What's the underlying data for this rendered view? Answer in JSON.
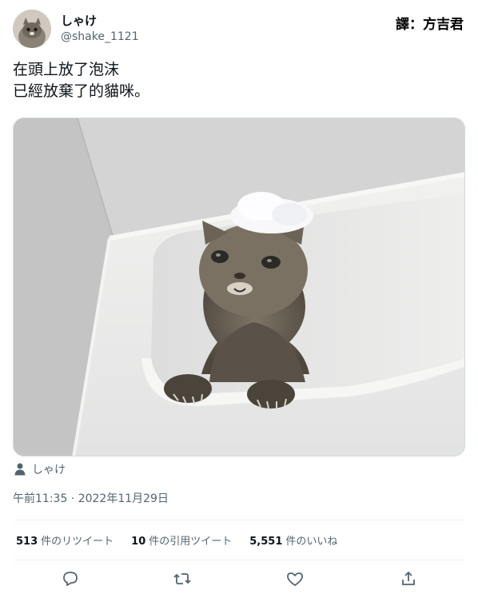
{
  "user": {
    "display_name": "しゃけ",
    "handle": "@shake_1121"
  },
  "watermark": "譯：方吉君",
  "tweet": {
    "line1": "在頭上放了泡沫",
    "line2": "已經放棄了的貓咪。"
  },
  "media_tag": "しゃけ",
  "timestamp": "午前11:35 · 2022年11月29日",
  "stats": {
    "retweets_count": "513",
    "retweets_label": "件のリツイート",
    "quotes_count": "10",
    "quotes_label": "件の引用ツイート",
    "likes_count": "5,551",
    "likes_label": "件のいいね"
  },
  "icons": {
    "reply": "reply-icon",
    "retweet": "retweet-icon",
    "like": "like-icon",
    "share": "share-icon"
  },
  "colors": {
    "text": "#0f1419",
    "secondary": "#536471",
    "divider": "#eff3f4"
  }
}
